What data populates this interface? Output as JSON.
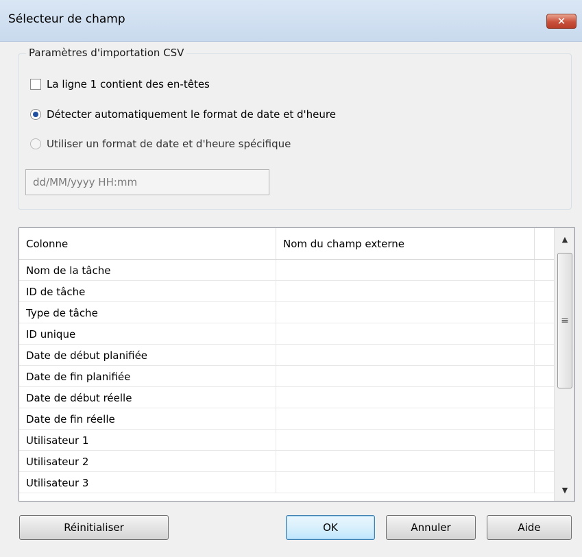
{
  "window": {
    "title": "Sélecteur de champ",
    "close_symbol": "✕"
  },
  "csv_settings": {
    "legend": "Paramètres d'importation CSV",
    "header_checkbox_label": "La ligne 1 contient des en-têtes",
    "header_checkbox_checked": false,
    "auto_detect_label": "Détecter automatiquement le format de date et d'heure",
    "auto_detect_selected": true,
    "specific_format_label": "Utiliser un format de date et d'heure spécifique",
    "specific_format_selected": false,
    "date_format_value": "dd/MM/yyyy HH:mm"
  },
  "grid": {
    "columns": [
      "Colonne",
      "Nom du champ externe"
    ],
    "rows": [
      {
        "colonne": "Nom de la tâche",
        "externe": ""
      },
      {
        "colonne": "ID de tâche",
        "externe": ""
      },
      {
        "colonne": "Type de tâche",
        "externe": ""
      },
      {
        "colonne": "ID unique",
        "externe": ""
      },
      {
        "colonne": "Date de début planifiée",
        "externe": ""
      },
      {
        "colonne": "Date de fin planifiée",
        "externe": ""
      },
      {
        "colonne": "Date de début réelle",
        "externe": ""
      },
      {
        "colonne": "Date de fin réelle",
        "externe": ""
      },
      {
        "colonne": "Utilisateur 1",
        "externe": ""
      },
      {
        "colonne": "Utilisateur 2",
        "externe": ""
      },
      {
        "colonne": "Utilisateur 3",
        "externe": ""
      }
    ]
  },
  "buttons": {
    "reset": "Réinitialiser",
    "ok": "OK",
    "cancel": "Annuler",
    "help": "Aide"
  },
  "icons": {
    "close": "close-icon",
    "scroll_up": "scroll-up-arrow-icon",
    "scroll_down": "scroll-down-arrow-icon",
    "grip": "scroll-thumb-grip-icon"
  }
}
